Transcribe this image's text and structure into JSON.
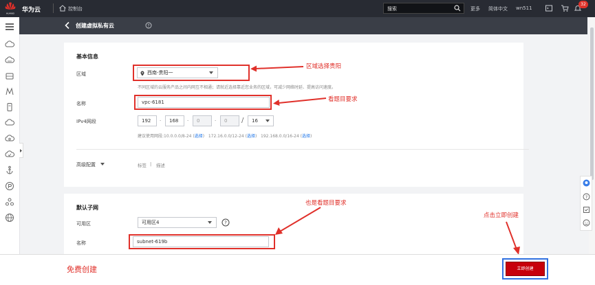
{
  "topbar": {
    "brand_small": "HUAWEI",
    "brand": "华为云",
    "console": "控制台",
    "search_placeholder": "搜索",
    "more": "更多",
    "language": "简体中文",
    "user": "wn511",
    "notification_count": "32"
  },
  "header": {
    "title": "创建虚拟私有云"
  },
  "basic": {
    "section_title": "基本信息",
    "region_label": "区域",
    "region_value": "西南-贵阳一",
    "region_hint": "不同区域的云服务产品之间内网互不相通；请就近选择靠近您业务的区域，可减少网络时延、提高访问速度。",
    "name_label": "名称",
    "name_value": "vpc-6181",
    "ipv4_label": "IPv4网段",
    "ip": [
      "192",
      "168",
      "0",
      "0"
    ],
    "mask": "16",
    "cidr_hint_prefix": "建议使用网段:",
    "cidr_options": [
      {
        "cidr": "10.0.0.0/8-24",
        "action": "选择"
      },
      {
        "cidr": "172.16.0.0/12-24",
        "action": "选择"
      },
      {
        "cidr": "192.168.0.0/16-24",
        "action": "选择"
      }
    ],
    "advanced_label": "高级配置",
    "advanced_tags": "标签",
    "advanced_desc": "描述",
    "advanced_sep": "|"
  },
  "subnet": {
    "section_title": "默认子网",
    "az_label": "可用区",
    "az_value": "可用区4",
    "name_label": "名称",
    "name_value": "subnet-619b"
  },
  "annotations": {
    "region": "区域选择贵阳",
    "name": "看题目要求",
    "subnet": "也是看题目要求",
    "create": "点击立即创建"
  },
  "footer": {
    "free_text": "免费创建",
    "create_button": "立即创建"
  },
  "colors": {
    "topbar": "#282b33",
    "header": "#3a3e47",
    "annotation": "#e0302a",
    "primary_button": "#c7000b",
    "link": "#1a73e8"
  }
}
